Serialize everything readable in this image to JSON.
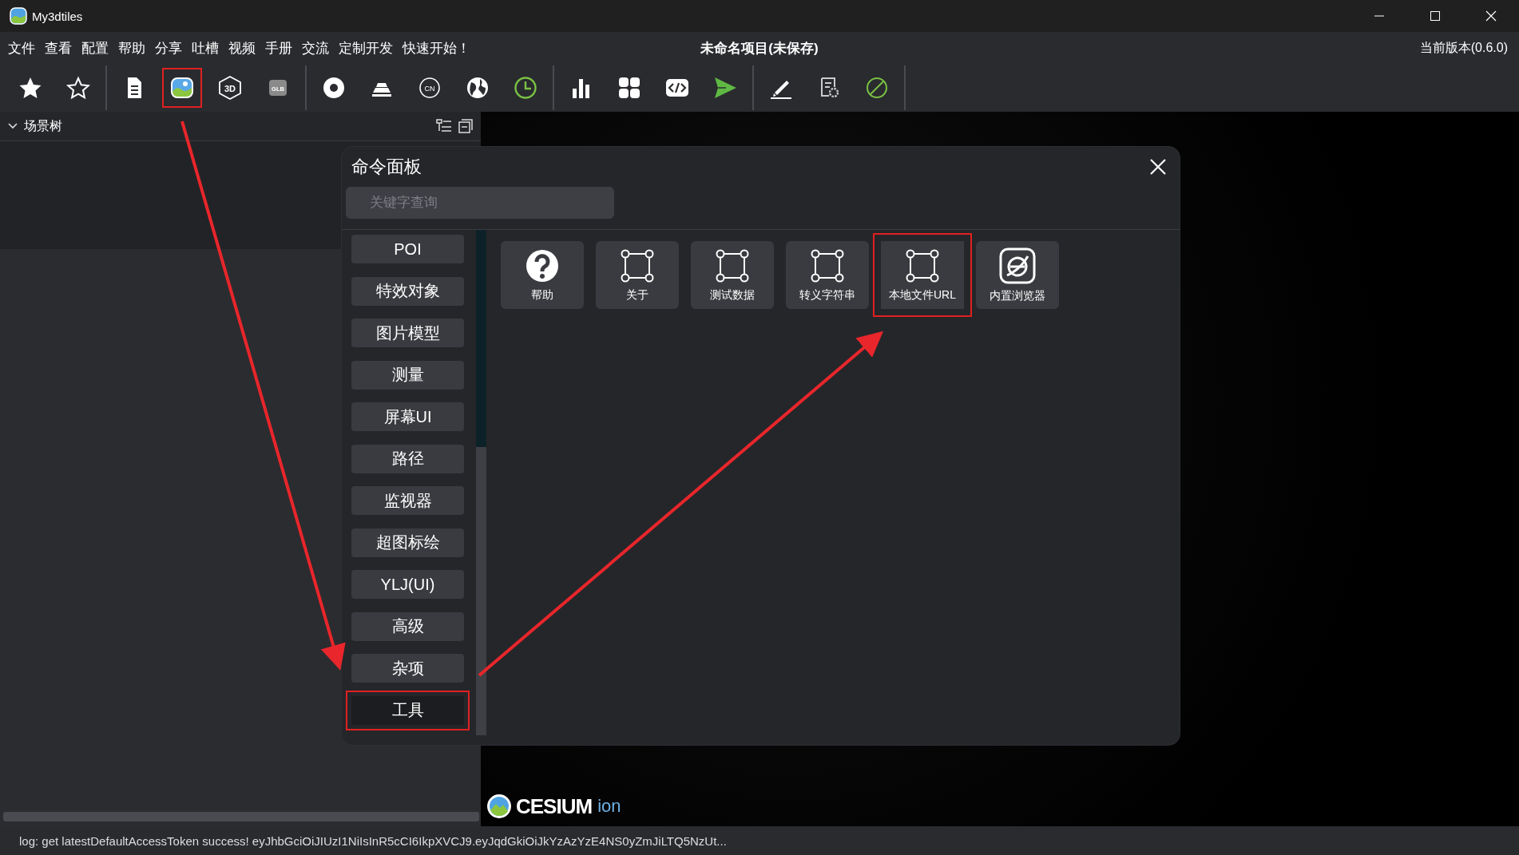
{
  "window": {
    "title": "My3dtiles"
  },
  "menu": [
    "文件",
    "查看",
    "配置",
    "帮助",
    "分享",
    "吐槽",
    "视频",
    "手册",
    "交流",
    "定制开发",
    "快速开始！"
  ],
  "project_title": "未命名项目(未保存)",
  "version": "当前版本(0.6.0)",
  "toolbar": [
    [
      {
        "kind": "star-filled",
        "highlighted": false
      },
      {
        "kind": "star-outline",
        "highlighted": false
      }
    ],
    [
      {
        "kind": "document",
        "highlighted": false
      },
      {
        "kind": "image",
        "highlighted": true
      },
      {
        "kind": "cube-3d",
        "text": "3D",
        "highlighted": false
      },
      {
        "kind": "glb",
        "text": "GLB",
        "highlighted": false
      }
    ],
    [
      {
        "kind": "disc",
        "highlighted": false
      },
      {
        "kind": "terrain",
        "highlighted": false
      },
      {
        "kind": "circle-text",
        "text": "CN",
        "highlighted": false
      },
      {
        "kind": "globe",
        "highlighted": false
      },
      {
        "kind": "clock",
        "highlighted": false
      }
    ],
    [
      {
        "kind": "bar-chart",
        "highlighted": false
      },
      {
        "kind": "grid",
        "highlighted": false
      },
      {
        "kind": "code",
        "highlighted": false
      },
      {
        "kind": "send",
        "highlighted": false
      }
    ],
    [
      {
        "kind": "pencil",
        "highlighted": false
      },
      {
        "kind": "settings-doc",
        "highlighted": false
      },
      {
        "kind": "ban",
        "highlighted": false
      }
    ]
  ],
  "scene_tree": {
    "title": "场景树",
    "expanded": true
  },
  "command_panel": {
    "title": "命令面板",
    "search": {
      "placeholder": "关键字查询"
    },
    "categories": [
      {
        "label": "POI",
        "selected": false,
        "highlighted": false
      },
      {
        "label": "特效对象",
        "selected": false,
        "highlighted": false
      },
      {
        "label": "图片模型",
        "selected": false,
        "highlighted": false
      },
      {
        "label": "测量",
        "selected": false,
        "highlighted": false
      },
      {
        "label": "屏幕UI",
        "selected": false,
        "highlighted": false
      },
      {
        "label": "路径",
        "selected": false,
        "highlighted": false
      },
      {
        "label": "监视器",
        "selected": false,
        "highlighted": false
      },
      {
        "label": "超图标绘",
        "selected": false,
        "highlighted": false
      },
      {
        "label": "YLJ(UI)",
        "selected": false,
        "highlighted": false
      },
      {
        "label": "高级",
        "selected": false,
        "highlighted": false
      },
      {
        "label": "杂项",
        "selected": false,
        "highlighted": false
      },
      {
        "label": "工具",
        "selected": true,
        "highlighted": true
      }
    ],
    "commands": [
      {
        "label": "帮助",
        "kind": "help",
        "highlighted": false
      },
      {
        "label": "关于",
        "kind": "square",
        "highlighted": false
      },
      {
        "label": "测试数据",
        "kind": "square",
        "highlighted": false
      },
      {
        "label": "转义字符串",
        "kind": "square",
        "highlighted": false
      },
      {
        "label": "本地文件URL",
        "kind": "square",
        "highlighted": true
      },
      {
        "label": "内置浏览器",
        "kind": "browser",
        "highlighted": false
      }
    ]
  },
  "viewport": {
    "logo": {
      "brand": "CESIUM",
      "suffix": "ion"
    }
  },
  "status_bar": {
    "log": "log: get latestDefaultAccessToken success! eyJhbGciOiJIUzI1NiIsInR5cCI6IkpXVCJ9.eyJqdGkiOiJkYzAzYzE4NS0yZmJiLTQ5NzUt..."
  }
}
